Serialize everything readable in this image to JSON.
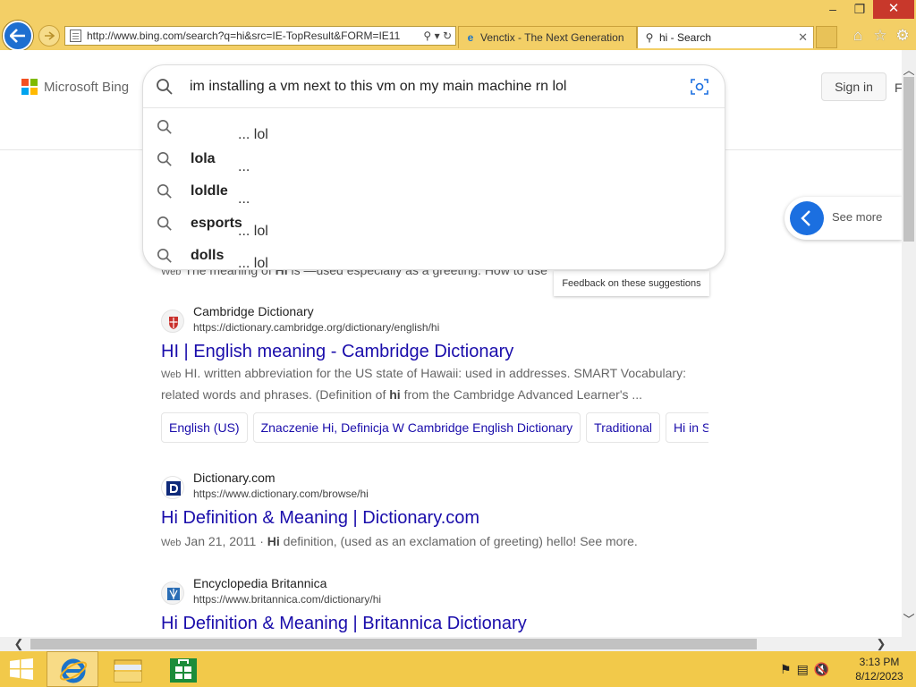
{
  "browser": {
    "address": "http://www.bing.com/search?q=hi&src=IE-TopResult&FORM=IE11",
    "tabs": [
      {
        "title": "Venctix - The Next Generation",
        "active": false
      },
      {
        "title": "hi - Search",
        "active": true
      }
    ]
  },
  "header": {
    "logo_text": "Microsoft Bing",
    "logo_colors": [
      "#f25022",
      "#7fba00",
      "#00a4ef",
      "#ffb900"
    ],
    "sign_in": "Sign in",
    "truncated_right": "F"
  },
  "search": {
    "query": "im installing a vm next to this vm on my main machine rn lol",
    "suggestions": [
      {
        "prefix": "... lol",
        "bold": ""
      },
      {
        "prefix": "... ",
        "bold": "lola"
      },
      {
        "prefix": "... ",
        "bold": "loldle"
      },
      {
        "prefix": "... lol ",
        "bold": "esports"
      },
      {
        "prefix": "... lol ",
        "bold": "dolls"
      }
    ],
    "feedback": "Feedback on these suggestions"
  },
  "see_more": "See more",
  "results": {
    "r0": {
      "web": "Web",
      "snippet_a": "The meaning of ",
      "snippet_b": "HI",
      "snippet_c": " is —used especially as a greeting. How to use"
    },
    "r1": {
      "site": "Cambridge Dictionary",
      "url": "https://dictionary.cambridge.org/dictionary/english/hi",
      "title": "HI | English meaning - Cambridge Dictionary",
      "web": "Web",
      "snippet_a": "HI. written abbreviation for the US state of Hawaii: used in addresses. SMART Vocabulary: related words and phrases. (Definition of ",
      "snippet_b": "hi",
      "snippet_c": " from the Cambridge Advanced Learner's ...",
      "deeplinks": [
        "English (US)",
        "Znaczenie Hi, Definicja W Cambridge English Dictionary",
        "Traditional",
        "Hi in S"
      ]
    },
    "r2": {
      "site": "Dictionary.com",
      "url": "https://www.dictionary.com/browse/hi",
      "title": "Hi Definition & Meaning | Dictionary.com",
      "web": "Web",
      "date": "Jan 21, 2011 · ",
      "snippet_b": "Hi",
      "snippet_c": " definition, (used as an exclamation of greeting) hello! See more."
    },
    "r3": {
      "site": "Encyclopedia Britannica",
      "url": "https://www.britannica.com/dictionary/hi",
      "title": "Hi Definition & Meaning | Britannica Dictionary"
    }
  },
  "taskbar": {
    "time": "3:13 PM",
    "date": "8/12/2023"
  }
}
